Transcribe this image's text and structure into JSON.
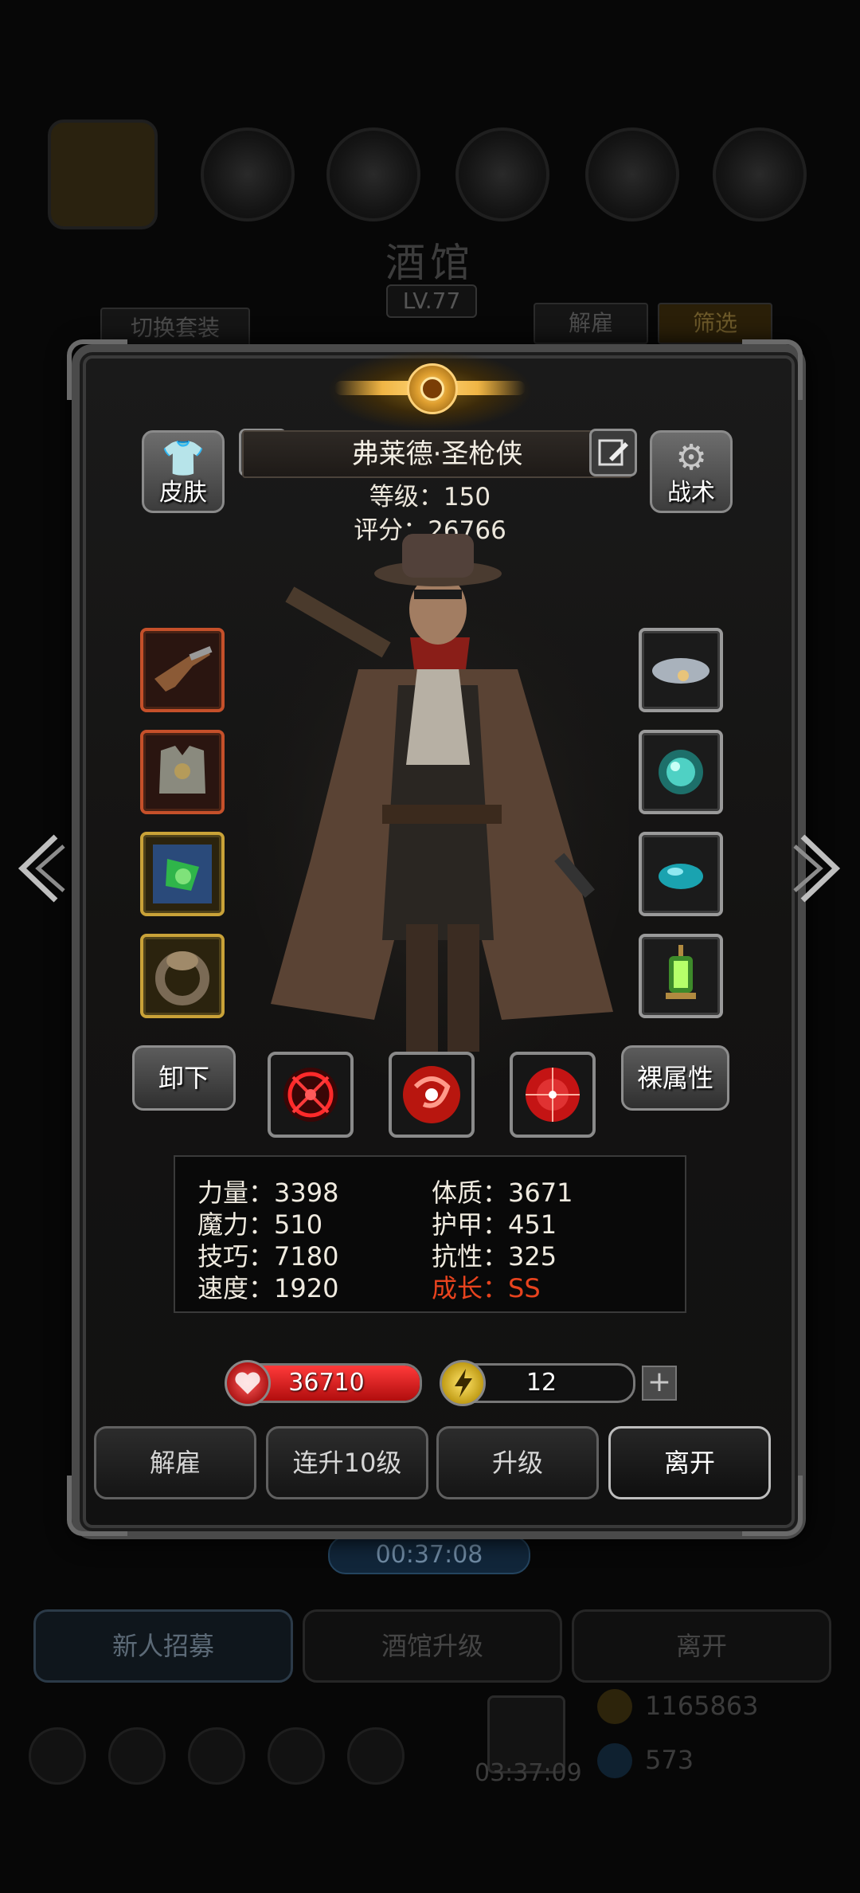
{
  "background": {
    "title": "酒馆",
    "level": "LV.77",
    "switch_outfit": "切换套装",
    "dismiss": "解雇",
    "filter": "筛选",
    "timer_main": "00:37:08",
    "recruit": "新人招募",
    "tavern_upgrade": "酒馆升级",
    "leave": "离开",
    "gold": "1165863",
    "gift_timer": "03:37:09",
    "gems": "573"
  },
  "hero": {
    "name": "弗莱德·圣枪侠",
    "level_text": "等级：150",
    "score_text": "评分：26766"
  },
  "side_buttons": {
    "skin": "皮肤",
    "tactics": "战术",
    "unequip": "卸下",
    "bare_stats": "裸属性"
  },
  "stats": {
    "strength": "力量：3398",
    "constitution": "体质：3671",
    "magic": "魔力：510",
    "armor": "护甲：451",
    "skill": "技巧：7180",
    "resistance": "抗性：325",
    "speed": "速度：1920",
    "growth": "成长：SS"
  },
  "hp": {
    "value": "36710",
    "fill": 1.0
  },
  "energy": {
    "value": "12",
    "fill": 0.08
  },
  "actions": {
    "dismiss": "解雇",
    "upgrade10": "连升10级",
    "upgrade": "升级",
    "leave": "离开"
  },
  "equipment_left": [
    "pistol",
    "chest-armor",
    "green-amulet",
    "ring"
  ],
  "equipment_right": [
    "cloud-charm",
    "teal-orb",
    "blue-gem",
    "lantern"
  ],
  "colors": {
    "accent_gold": "#f0b545",
    "hp_red": "#d11a1a",
    "energy_yellow": "#e6c21a",
    "growth_red": "#e8431e"
  }
}
